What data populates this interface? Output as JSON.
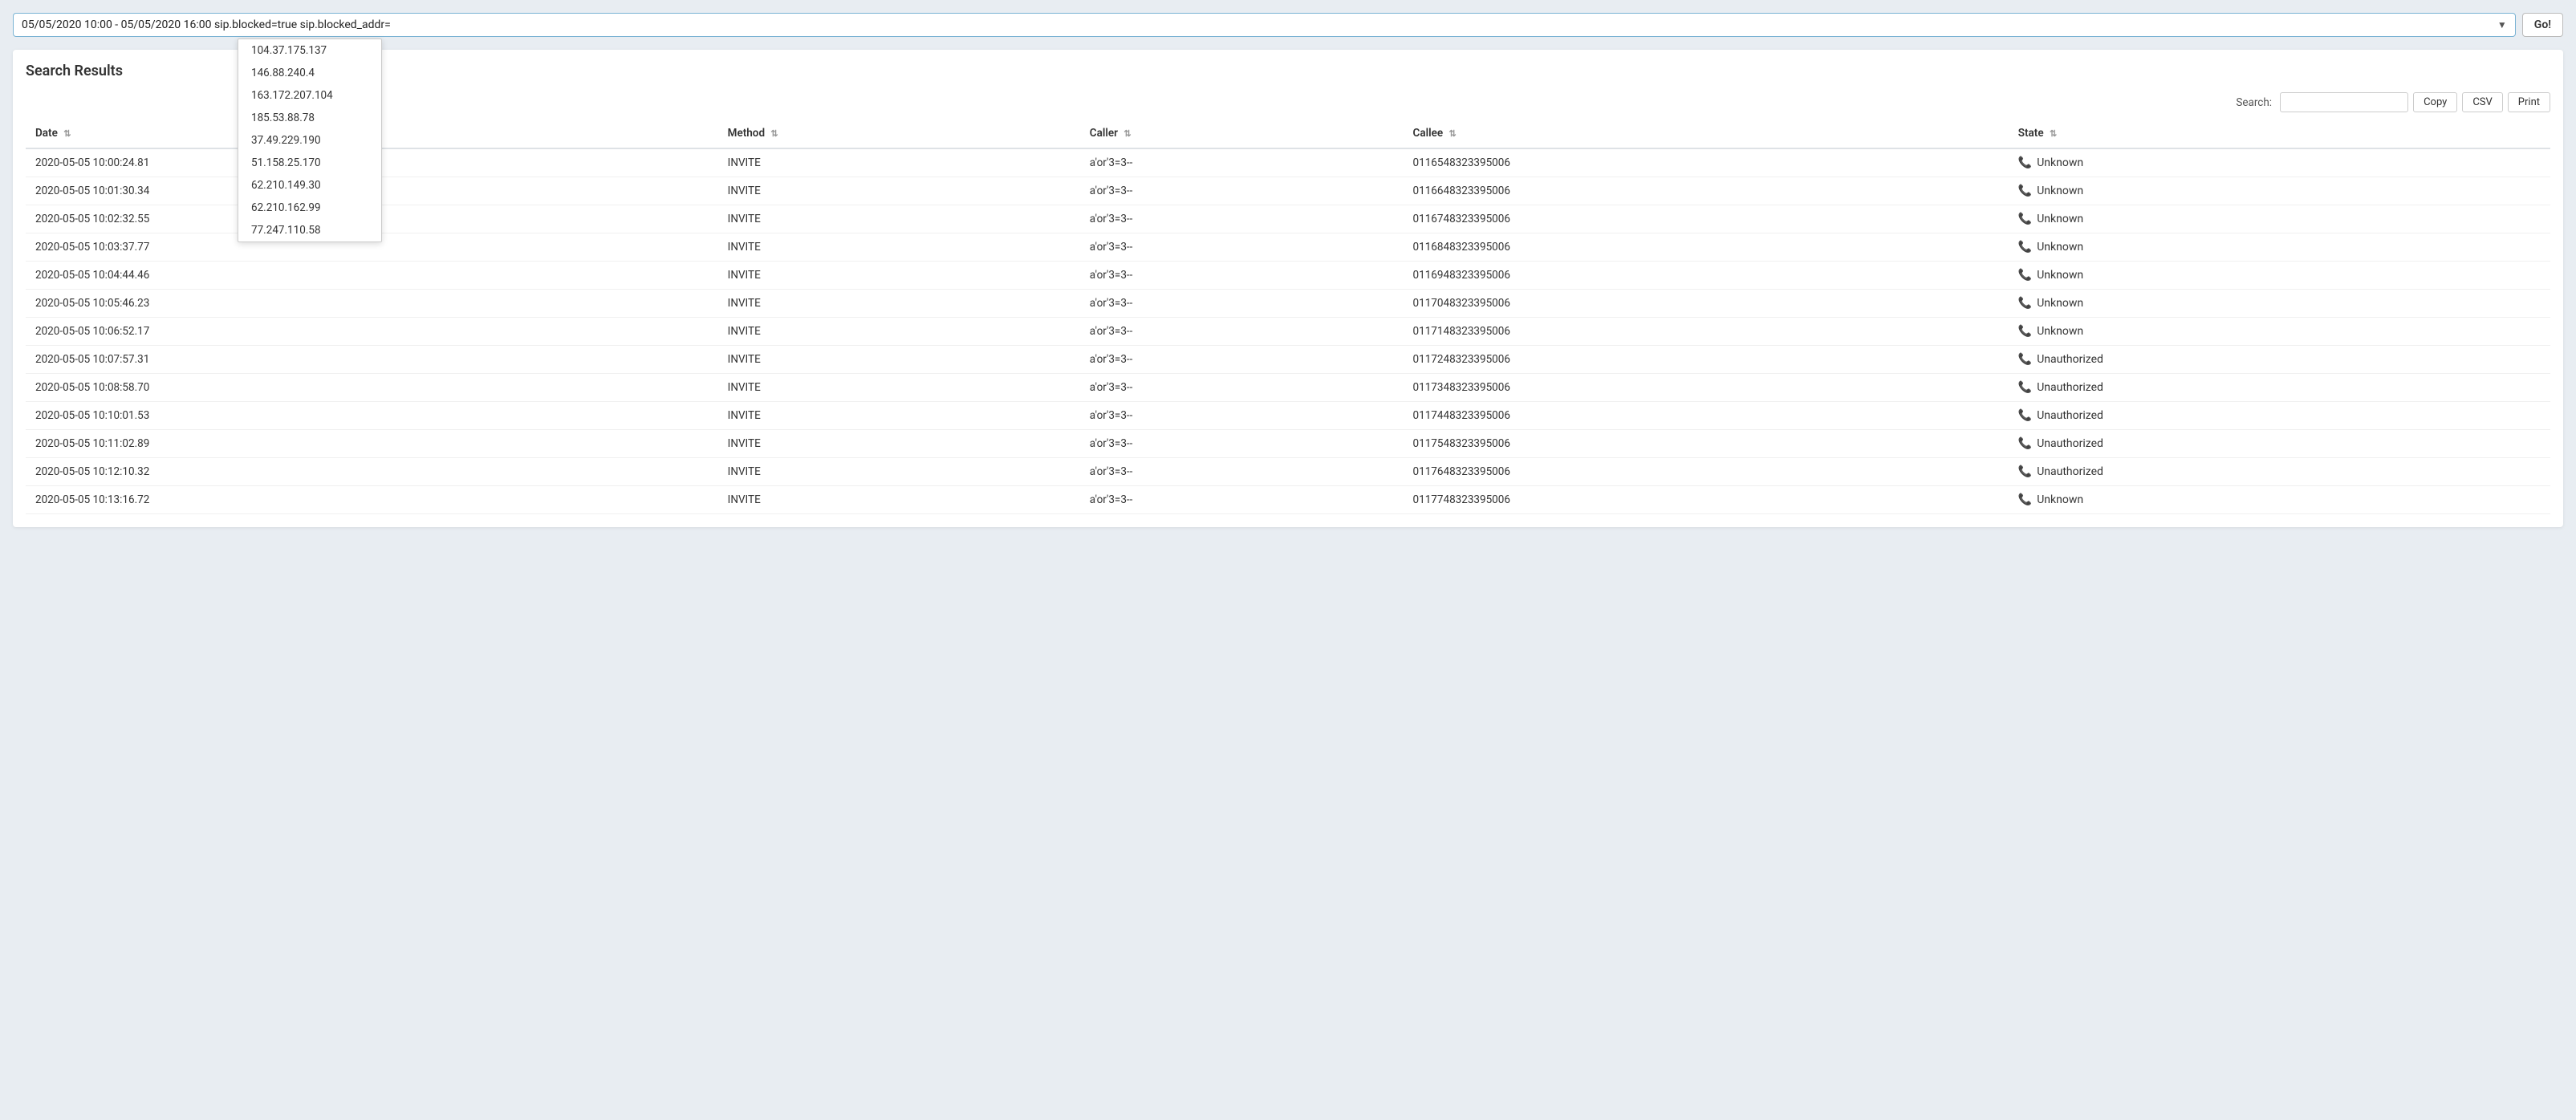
{
  "searchBar": {
    "value": "05/05/2020 10:00 - 05/05/2020 16:00 sip.blocked=true sip.blocked_addr=",
    "placeholder": "",
    "goLabel": "Go!"
  },
  "autocomplete": {
    "items": [
      "104.37.175.137",
      "146.88.240.4",
      "163.172.207.104",
      "185.53.88.78",
      "37.49.229.190",
      "51.158.25.170",
      "62.210.149.30",
      "62.210.162.99",
      "77.247.110.58"
    ]
  },
  "resultsTitle": "Search Results",
  "toolbar": {
    "searchLabel": "Search:",
    "copyLabel": "Copy",
    "csvLabel": "CSV",
    "printLabel": "Print"
  },
  "table": {
    "columns": [
      {
        "id": "date",
        "label": "Date",
        "sortable": true
      },
      {
        "id": "method",
        "label": "Method",
        "sortable": true
      },
      {
        "id": "caller",
        "label": "Caller",
        "sortable": true
      },
      {
        "id": "callee",
        "label": "Callee",
        "sortable": true
      },
      {
        "id": "state",
        "label": "State",
        "sortable": true
      }
    ],
    "rows": [
      {
        "date": "2020-05-05 10:00:24.81",
        "method": "INVITE",
        "caller": "a'or'3=3--",
        "callee": "0116548323395006",
        "state": "Unknown",
        "stateType": "unknown"
      },
      {
        "date": "2020-05-05 10:01:30.34",
        "method": "INVITE",
        "caller": "a'or'3=3--",
        "callee": "0116648323395006",
        "state": "Unknown",
        "stateType": "unknown"
      },
      {
        "date": "2020-05-05 10:02:32.55",
        "method": "INVITE",
        "caller": "a'or'3=3--",
        "callee": "0116748323395006",
        "state": "Unknown",
        "stateType": "unknown"
      },
      {
        "date": "2020-05-05 10:03:37.77",
        "method": "INVITE",
        "caller": "a'or'3=3--",
        "callee": "0116848323395006",
        "state": "Unknown",
        "stateType": "unknown"
      },
      {
        "date": "2020-05-05 10:04:44.46",
        "method": "INVITE",
        "caller": "a'or'3=3--",
        "callee": "0116948323395006",
        "state": "Unknown",
        "stateType": "unknown"
      },
      {
        "date": "2020-05-05 10:05:46.23",
        "method": "INVITE",
        "caller": "a'or'3=3--",
        "callee": "0117048323395006",
        "state": "Unknown",
        "stateType": "unknown"
      },
      {
        "date": "2020-05-05 10:06:52.17",
        "method": "INVITE",
        "caller": "a'or'3=3--",
        "callee": "0117148323395006",
        "state": "Unknown",
        "stateType": "unknown"
      },
      {
        "date": "2020-05-05 10:07:57.31",
        "method": "INVITE",
        "caller": "a'or'3=3--",
        "callee": "0117248323395006",
        "state": "Unauthorized",
        "stateType": "unauthorized"
      },
      {
        "date": "2020-05-05 10:08:58.70",
        "method": "INVITE",
        "caller": "a'or'3=3--",
        "callee": "0117348323395006",
        "state": "Unauthorized",
        "stateType": "unauthorized"
      },
      {
        "date": "2020-05-05 10:10:01.53",
        "method": "INVITE",
        "caller": "a'or'3=3--",
        "callee": "0117448323395006",
        "state": "Unauthorized",
        "stateType": "unauthorized"
      },
      {
        "date": "2020-05-05 10:11:02.89",
        "method": "INVITE",
        "caller": "a'or'3=3--",
        "callee": "0117548323395006",
        "state": "Unauthorized",
        "stateType": "unauthorized"
      },
      {
        "date": "2020-05-05 10:12:10.32",
        "method": "INVITE",
        "caller": "a'or'3=3--",
        "callee": "0117648323395006",
        "state": "Unauthorized",
        "stateType": "unauthorized"
      },
      {
        "date": "2020-05-05 10:13:16.72",
        "method": "INVITE",
        "caller": "a'or'3=3--",
        "callee": "0117748323395006",
        "state": "Unknown",
        "stateType": "unknown"
      }
    ]
  },
  "colors": {
    "unknownPhoneIcon": "#444444",
    "unauthorizedPhoneIcon": "#7ab0d4"
  }
}
